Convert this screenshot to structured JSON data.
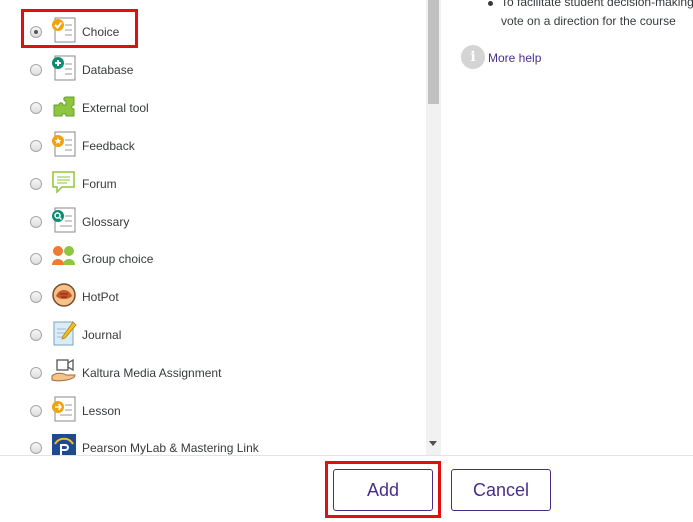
{
  "activities": [
    {
      "label": "Choice",
      "icon": "choice-icon",
      "selected": true
    },
    {
      "label": "Database",
      "icon": "database-icon",
      "selected": false
    },
    {
      "label": "External tool",
      "icon": "external-tool-icon",
      "selected": false
    },
    {
      "label": "Feedback",
      "icon": "feedback-icon",
      "selected": false
    },
    {
      "label": "Forum",
      "icon": "forum-icon",
      "selected": false
    },
    {
      "label": "Glossary",
      "icon": "glossary-icon",
      "selected": false
    },
    {
      "label": "Group choice",
      "icon": "group-choice-icon",
      "selected": false
    },
    {
      "label": "HotPot",
      "icon": "hotpot-icon",
      "selected": false
    },
    {
      "label": "Journal",
      "icon": "journal-icon",
      "selected": false
    },
    {
      "label": "Kaltura Media Assignment",
      "icon": "kaltura-icon",
      "selected": false
    },
    {
      "label": "Lesson",
      "icon": "lesson-icon",
      "selected": false
    },
    {
      "label": "Pearson MyLab & Mastering Link",
      "icon": "pearson-icon",
      "selected": false
    }
  ],
  "help": {
    "bullet_line1": "To facilitate student decision-making",
    "bullet_line2": "vote on a direction for the course",
    "more_help": "More help"
  },
  "footer": {
    "add_label": "Add",
    "cancel_label": "Cancel"
  },
  "colors": {
    "brand": "#4a2d8a",
    "highlight": "#e01010"
  }
}
